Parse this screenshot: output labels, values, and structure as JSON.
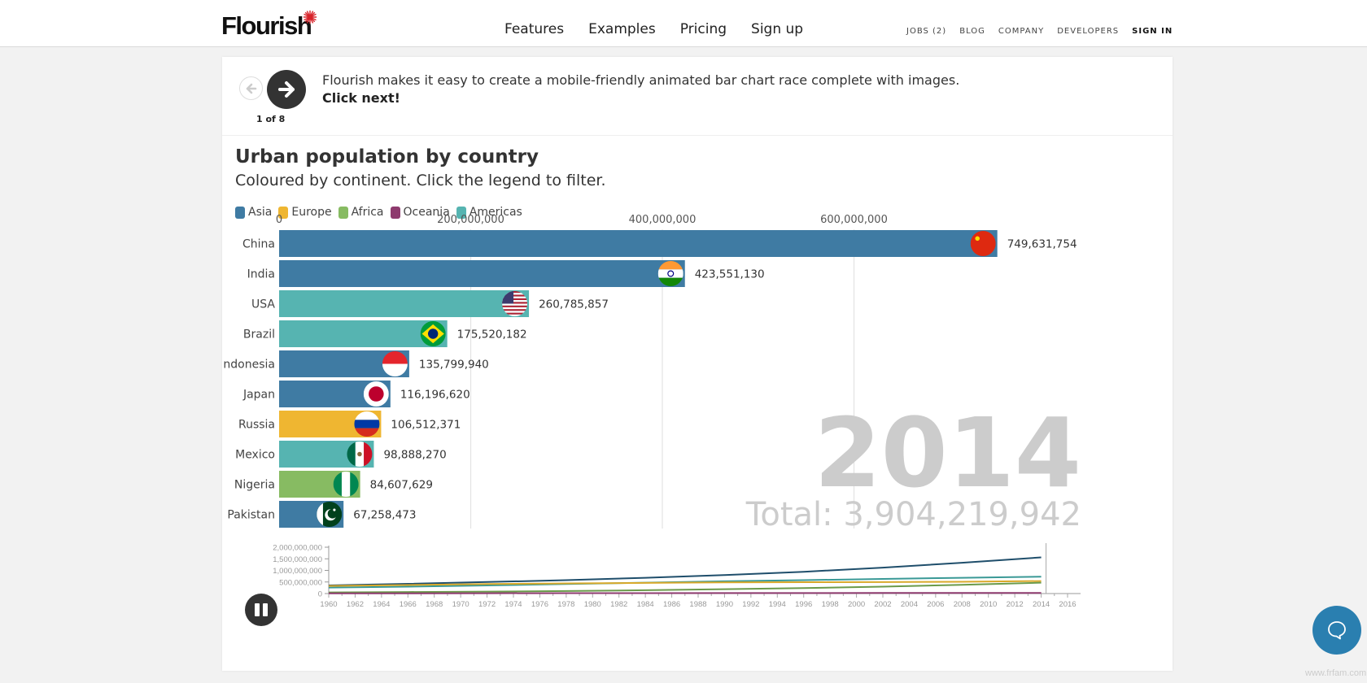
{
  "nav": {
    "logo": "Flourish",
    "main_links": [
      "Features",
      "Examples",
      "Pricing",
      "Sign up"
    ],
    "sub_links": [
      "JOBS (2)",
      "BLOG",
      "COMPANY",
      "DEVELOPERS",
      "SIGN IN"
    ]
  },
  "story": {
    "text": "Flourish makes it easy to create a mobile-friendly animated bar chart race complete with images.",
    "cta": "Click next!",
    "step": "1 of 8"
  },
  "watermark": "www.frfam.com",
  "colors": {
    "Asia": "#3f7ba3",
    "Europe": "#efb631",
    "Africa": "#87bb62",
    "Oceania": "#8e3a6e",
    "Americas": "#56b4b1",
    "asia_line": "#1f4e6b",
    "americas_line": "#3a9996",
    "europe_line": "#d9a92a",
    "africa_line": "#6a9a4a",
    "oceania_line": "#8e3a6e"
  },
  "chart_data": [
    {
      "type": "bar",
      "title": "Urban population by country",
      "subtitle": "Coloured by continent. Click the legend to filter.",
      "legend": [
        "Asia",
        "Europe",
        "Africa",
        "Oceania",
        "Americas"
      ],
      "legend_position": "top-left",
      "xlim": [
        0,
        750000000
      ],
      "xticks": [
        0,
        200000000,
        400000000,
        600000000
      ],
      "xtick_labels": [
        "0",
        "200,000,000",
        "400,000,000",
        "600,000,000"
      ],
      "grid": true,
      "year": "2014",
      "total_label": "Total: 3,904,219,942",
      "categories": [
        "China",
        "India",
        "USA",
        "Brazil",
        "Indonesia",
        "Japan",
        "Russia",
        "Mexico",
        "Nigeria",
        "Pakistan"
      ],
      "values": [
        749631754,
        423551130,
        260785857,
        175520182,
        135799940,
        116196620,
        106512371,
        98888270,
        84607629,
        67258473
      ],
      "value_labels": [
        "749,631,754",
        "423,551,130",
        "260,785,857",
        "175,520,182",
        "135,799,940",
        "116,196,620",
        "106,512,371",
        "98,888,270",
        "84,607,629",
        "67,258,473"
      ],
      "continents": [
        "Asia",
        "Asia",
        "Americas",
        "Americas",
        "Asia",
        "Asia",
        "Europe",
        "Americas",
        "Africa",
        "Asia"
      ],
      "flags": [
        "china-flag",
        "india-flag",
        "usa-flag",
        "brazil-flag",
        "indonesia-flag",
        "japan-flag",
        "russia-flag",
        "mexico-flag",
        "nigeria-flag",
        "pakistan-flag"
      ]
    },
    {
      "type": "line",
      "title": "",
      "ylim": [
        0,
        2000000000
      ],
      "yticks": [
        0,
        500000000,
        1000000000,
        1500000000,
        2000000000
      ],
      "ytick_labels": [
        "0",
        "500,000,000",
        "1,000,000,000",
        "1,500,000,000",
        "2,000,000,000"
      ],
      "xlim": [
        1960,
        2016
      ],
      "xticks": [
        1960,
        1962,
        1964,
        1966,
        1968,
        1970,
        1972,
        1974,
        1976,
        1978,
        1980,
        1982,
        1984,
        1986,
        1988,
        1990,
        1992,
        1994,
        1996,
        1998,
        2000,
        2002,
        2004,
        2006,
        2008,
        2010,
        2012,
        2014,
        2016
      ],
      "current_year": 2014,
      "x": [
        1960,
        1966,
        1972,
        1978,
        1984,
        1990,
        1996,
        2002,
        2008,
        2014
      ],
      "series": [
        {
          "name": "Asia",
          "values": [
            350000000,
            420000000,
            500000000,
            580000000,
            680000000,
            800000000,
            940000000,
            1120000000,
            1330000000,
            1560000000
          ]
        },
        {
          "name": "Americas",
          "values": [
            260000000,
            300000000,
            350000000,
            410000000,
            470000000,
            530000000,
            580000000,
            630000000,
            680000000,
            730000000
          ]
        },
        {
          "name": "Europe",
          "values": [
            330000000,
            370000000,
            410000000,
            440000000,
            460000000,
            480000000,
            490000000,
            495000000,
            510000000,
            540000000
          ]
        },
        {
          "name": "Africa",
          "values": [
            50000000,
            65000000,
            85000000,
            110000000,
            145000000,
            190000000,
            240000000,
            300000000,
            380000000,
            470000000
          ]
        },
        {
          "name": "Oceania",
          "values": [
            10000000,
            12000000,
            14000000,
            16000000,
            18000000,
            20000000,
            22000000,
            24000000,
            26000000,
            28000000
          ]
        }
      ]
    }
  ]
}
